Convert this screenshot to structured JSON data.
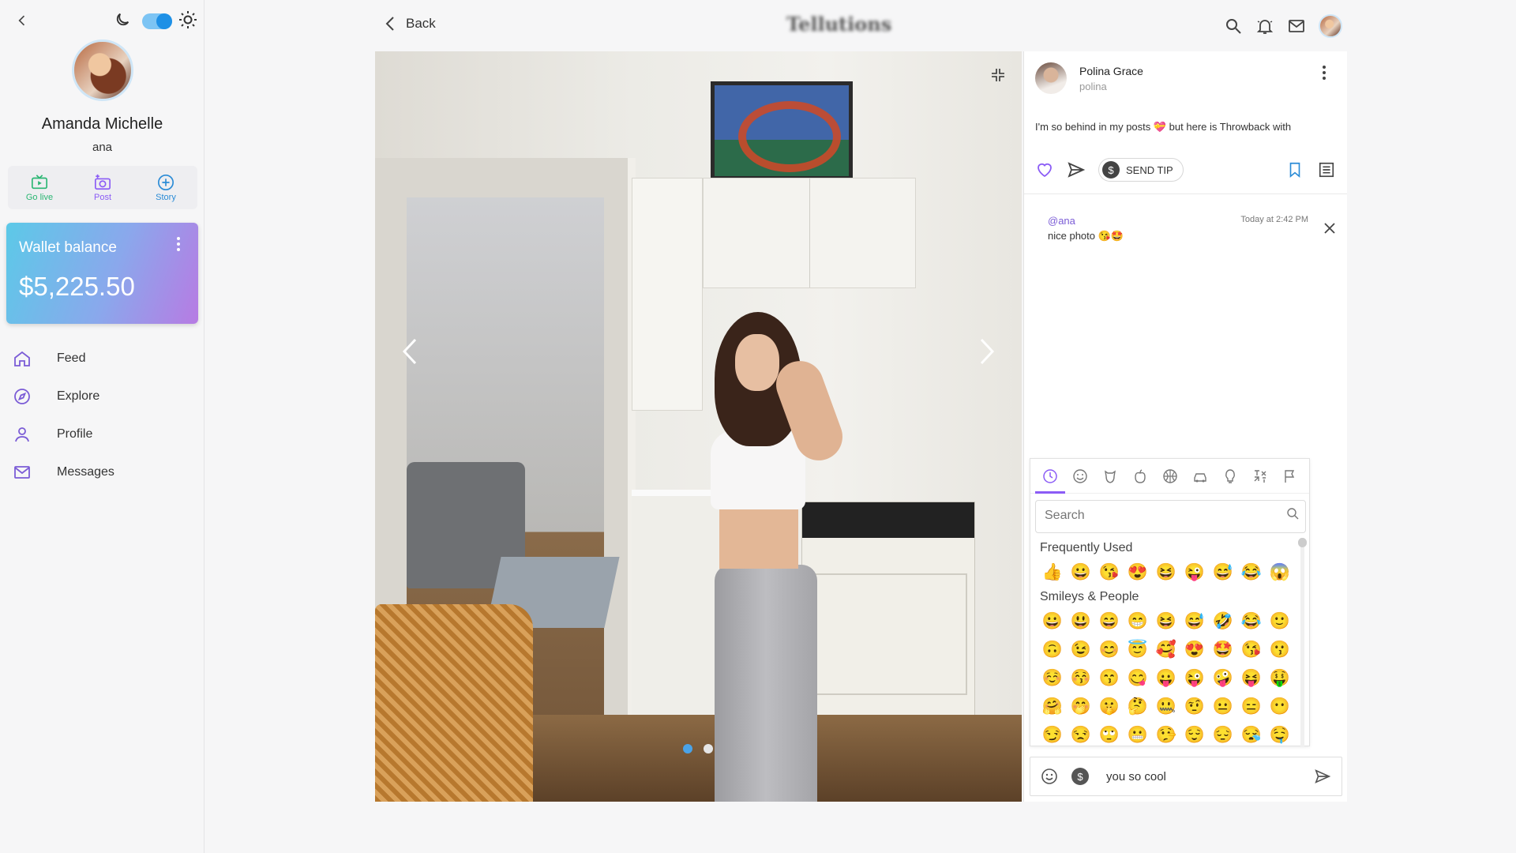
{
  "sidebar": {
    "user_name": "Amanda Michelle",
    "user_handle": "ana",
    "quick_actions": [
      {
        "label": "Go live",
        "icon": "tv-icon",
        "color": "#2bb673"
      },
      {
        "label": "Post",
        "icon": "camera-plus-icon",
        "color": "#8b5cf6"
      },
      {
        "label": "Story",
        "icon": "plus-circle-icon",
        "color": "#2a8bd6"
      }
    ],
    "wallet": {
      "title": "Wallet balance",
      "amount": "$5,225.50"
    },
    "nav": [
      {
        "label": "Feed",
        "icon": "home-icon"
      },
      {
        "label": "Explore",
        "icon": "compass-icon"
      },
      {
        "label": "Profile",
        "icon": "user-icon"
      },
      {
        "label": "Messages",
        "icon": "mail-icon"
      }
    ],
    "theme_toggle_on": true
  },
  "topbar": {
    "back_label": "Back",
    "brand": "Tellutions",
    "icons": [
      "search-icon",
      "bell-icon",
      "mail-icon",
      "avatar"
    ]
  },
  "post": {
    "author_name": "Polina Grace",
    "author_handle": "polina",
    "caption": "I'm so behind in my posts 💝 but here is Throwback with",
    "tip_label": "SEND TIP",
    "tip_symbol": "$",
    "carousel": {
      "total": 2,
      "active": 1
    }
  },
  "comment": {
    "user": "@ana",
    "text": "nice photo 😘🤩",
    "time": "Today at 2:42 PM"
  },
  "emoji_picker": {
    "search_placeholder": "Search",
    "categories": [
      "clock-icon",
      "smiley-icon",
      "animal-icon",
      "food-icon",
      "ball-icon",
      "car-icon",
      "bulb-icon",
      "symbols-icon",
      "flag-icon"
    ],
    "sections": [
      {
        "title": "Frequently Used",
        "rows": [
          [
            "👍",
            "😀",
            "😘",
            "😍",
            "😆",
            "😜",
            "😅",
            "😂",
            "😱"
          ]
        ]
      },
      {
        "title": "Smileys & People",
        "rows": [
          [
            "😀",
            "😃",
            "😄",
            "😁",
            "😆",
            "😅",
            "🤣",
            "😂",
            "🙂"
          ],
          [
            "🙃",
            "😉",
            "😊",
            "😇",
            "🥰",
            "😍",
            "🤩",
            "😘",
            "😗"
          ],
          [
            "☺️",
            "😚",
            "😙",
            "😋",
            "😛",
            "😜",
            "🤪",
            "😝",
            "🤑"
          ],
          [
            "🤗",
            "🤭",
            "🤫",
            "🤔",
            "🤐",
            "🤨",
            "😐",
            "😑",
            "😶"
          ],
          [
            "😏",
            "😒",
            "🙄",
            "😬",
            "🤥",
            "😌",
            "😔",
            "😪",
            "🤤"
          ]
        ]
      }
    ]
  },
  "composer": {
    "value": "you so cool",
    "tip_symbol": "$"
  },
  "colors": {
    "accent": "#8b5cf6",
    "link": "#7b5cd6",
    "toggle": "#1e90e6"
  }
}
